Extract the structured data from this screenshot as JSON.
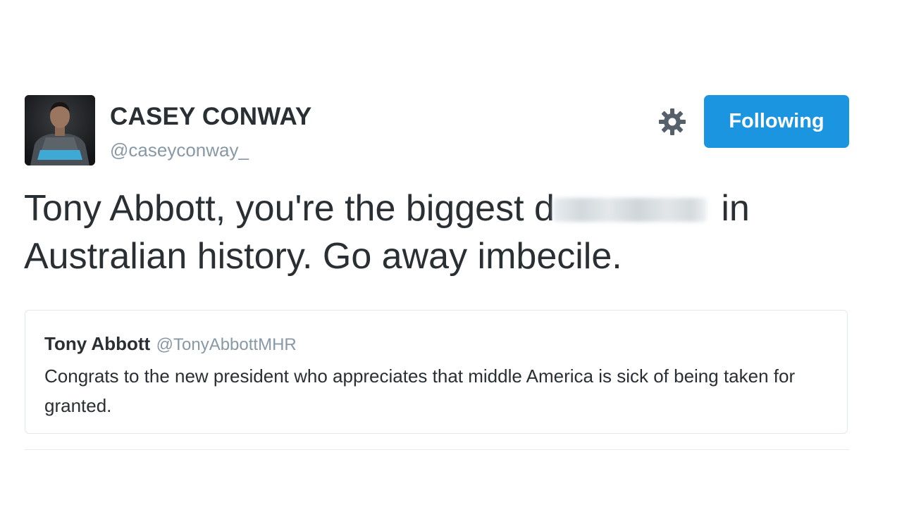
{
  "author": {
    "display_name": "CASEY CONWAY",
    "handle": "@caseyconway_"
  },
  "actions": {
    "follow_label": "Following",
    "accent_color": "#1b95e0",
    "settings_icon": "gear-icon"
  },
  "tweet": {
    "text_before": "Tony Abbott, you're the biggest d",
    "text_after": " in Australian history. Go away imbecile."
  },
  "quoted_tweet": {
    "author_name": "Tony Abbott",
    "author_handle": "@TonyAbbottMHR",
    "text": "Congrats to the new president who appreciates that middle America is sick of being taken for granted."
  }
}
